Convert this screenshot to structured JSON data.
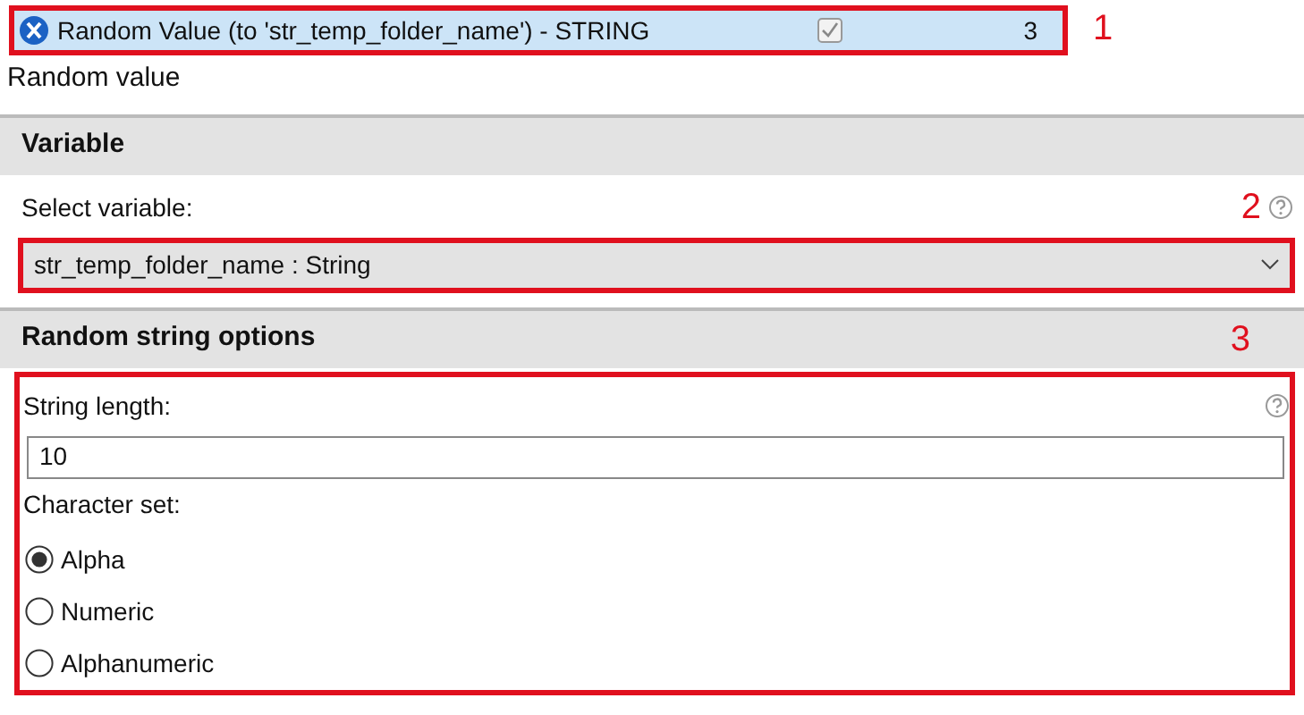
{
  "node_row": {
    "title": "Random Value (to 'str_temp_folder_name') - STRING",
    "checked": true,
    "count": "3",
    "callout": "1"
  },
  "description": "Random value",
  "sections": [
    {
      "title": "Variable",
      "callout": "2",
      "fields": [
        {
          "kind": "select",
          "label": "Select variable:",
          "help": true,
          "value": "str_temp_folder_name : String"
        }
      ]
    },
    {
      "title": "Random string options",
      "callout": "3",
      "fields": [
        {
          "kind": "text",
          "label": "String length:",
          "help": true,
          "value": "10"
        },
        {
          "kind": "radio",
          "label": "Character set:",
          "options": [
            {
              "label": "Alpha",
              "selected": true
            },
            {
              "label": "Numeric",
              "selected": false
            },
            {
              "label": "Alphanumeric",
              "selected": false
            }
          ]
        }
      ]
    }
  ]
}
